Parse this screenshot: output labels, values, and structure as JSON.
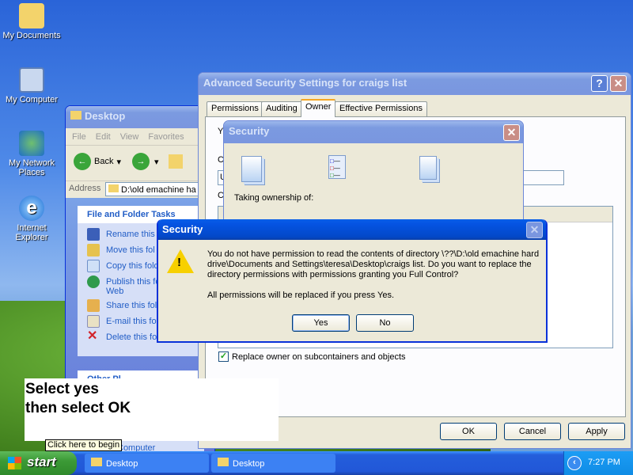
{
  "desktop_icons": [
    {
      "label": "My Documents"
    },
    {
      "label": "My Computer"
    },
    {
      "label": "My Network Places"
    },
    {
      "label": "Internet Explorer"
    }
  ],
  "explorer": {
    "title": "Desktop",
    "menu": [
      "File",
      "Edit",
      "View",
      "Favorites"
    ],
    "back": "Back",
    "address_label": "Address",
    "address_value": "D:\\old emachine ha",
    "tasks_title": "File and Folder Tasks",
    "tasks": [
      "Rename this fo",
      "Move this fol",
      "Copy this fold",
      "Publish this fo",
      "Web",
      "Share this fold",
      "E-mail this fol",
      "Delete this folder"
    ],
    "other_places_title": "Other Pl",
    "other_item": "Computer"
  },
  "advanced": {
    "title": "Advanced Security Settings for craigs list",
    "tabs": [
      "Permissions",
      "Auditing",
      "Owner",
      "Effective Permissions"
    ],
    "active_tab": "Owner",
    "partial_labels": [
      "Y",
      "C",
      "U",
      "C"
    ],
    "checkbox_label": "Replace owner on subcontainers and objects",
    "checkbox_checked": true,
    "ok": "OK",
    "cancel": "Cancel",
    "apply": "Apply"
  },
  "progress_dialog": {
    "title": "Security",
    "text": "Taking ownership of:"
  },
  "confirm_dialog": {
    "title": "Security",
    "message": "You do not have permission to read the contents of directory \\??\\D:\\old emachine hard drive\\Documents and Settings\\teresa\\Desktop\\craigs list. Do you want to replace the directory permissions with permissions granting you Full Control?",
    "note": "All permissions will be replaced if you press Yes.",
    "yes": "Yes",
    "no": "No"
  },
  "annotation": {
    "line1": "Select yes",
    "line2": "then select OK"
  },
  "tooltip": "Click here to begin",
  "taskbar": {
    "start": "start",
    "buttons": [
      "Desktop",
      "Desktop"
    ],
    "clock": "7:27 PM"
  }
}
